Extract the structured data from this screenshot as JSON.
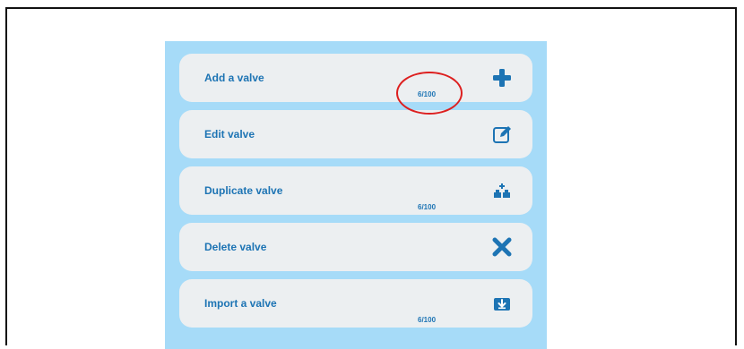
{
  "colors": {
    "panel_background": "#a6dbf8",
    "item_background": "#eceff1",
    "accent": "#1d74b4",
    "highlight": "#dd1f1f"
  },
  "menu": {
    "items": [
      {
        "label": "Add a valve",
        "count": "6/100",
        "icon": "plus-icon"
      },
      {
        "label": "Edit valve",
        "count": "",
        "icon": "edit-icon"
      },
      {
        "label": "Duplicate valve",
        "count": "6/100",
        "icon": "duplicate-icon"
      },
      {
        "label": "Delete valve",
        "count": "",
        "icon": "delete-x-icon"
      },
      {
        "label": "Import a valve",
        "count": "6/100",
        "icon": "import-icon"
      }
    ]
  }
}
